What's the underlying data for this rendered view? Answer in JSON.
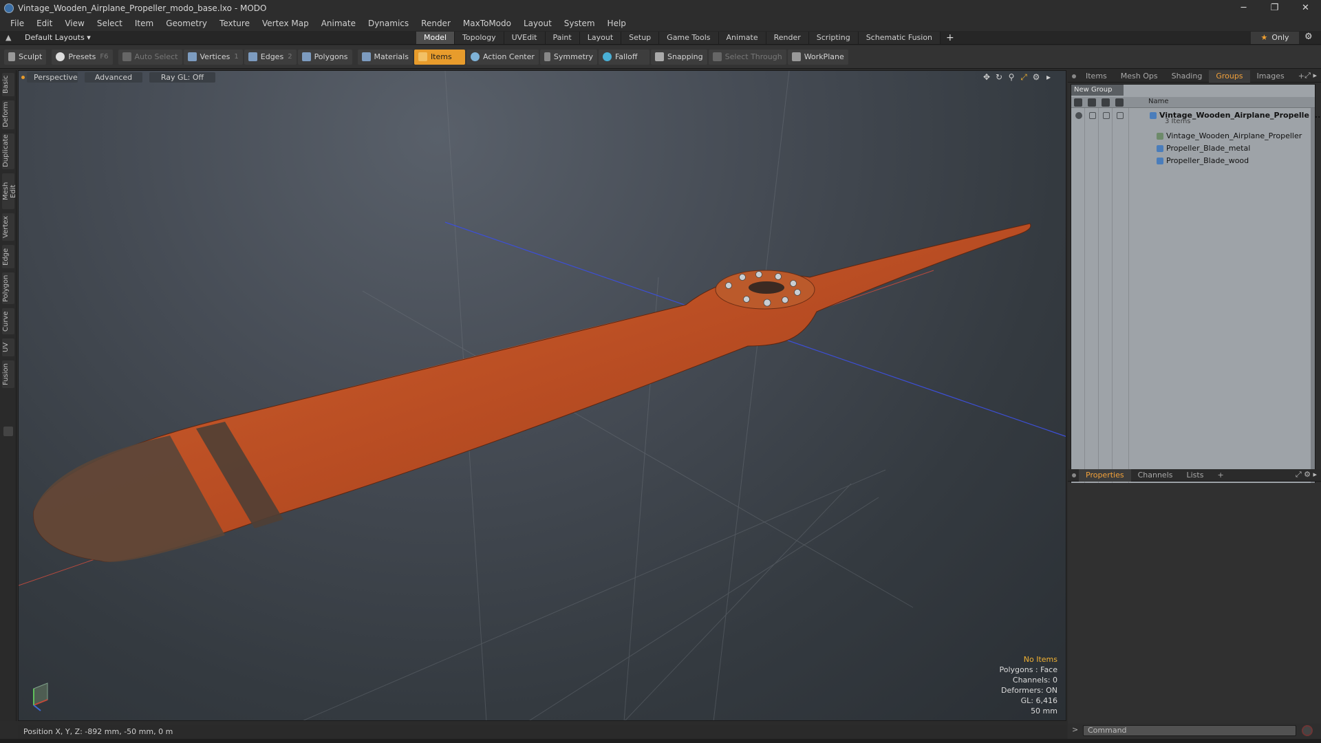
{
  "window": {
    "title": "Vintage_Wooden_Airplane_Propeller_modo_base.lxo - MODO",
    "minimize": "─",
    "maximize": "❐",
    "close": "✕"
  },
  "menu": [
    "File",
    "Edit",
    "View",
    "Select",
    "Item",
    "Geometry",
    "Texture",
    "Vertex Map",
    "Animate",
    "Dynamics",
    "Render",
    "MaxToModo",
    "Layout",
    "System",
    "Help"
  ],
  "layoutbar": {
    "layout_select": "Default Layouts ▾",
    "tabs": [
      "Model",
      "Topology",
      "UVEdit",
      "Paint",
      "Layout",
      "Setup",
      "Game Tools",
      "Animate",
      "Render",
      "Scripting",
      "Schematic Fusion"
    ],
    "active_tab": "Model",
    "add_tab": "+",
    "only_label": "Only",
    "star": "★",
    "gear": "⚙"
  },
  "toolbar": {
    "sculpt": "Sculpt",
    "presets": "Presets",
    "presets_key": "F6",
    "auto_select": "Auto Select",
    "vertices": "Vertices",
    "vertices_key": "1",
    "edges": "Edges",
    "edges_key": "2",
    "polygons": "Polygons",
    "materials": "Materials",
    "items": "Items",
    "action_center": "Action Center",
    "symmetry": "Symmetry",
    "falloff": "Falloff",
    "snapping": "Snapping",
    "select_through": "Select Through",
    "workplane": "WorkPlane"
  },
  "left_tabs": [
    "Basic",
    "Deform",
    "Duplicate",
    "Mesh Edit",
    "Vertex",
    "Edge",
    "Polygon",
    "Curve",
    "UV",
    "Fusion"
  ],
  "viewport": {
    "perspective": "Perspective",
    "advanced": "Advanced",
    "raygl": "Ray GL: Off",
    "icons": [
      "✥",
      "↻",
      "⚲",
      "⤢",
      "⚙",
      "▸"
    ],
    "info": {
      "no_items": "No Items",
      "polygons": "Polygons : Face",
      "channels": "Channels: 0",
      "deformers": "Deformers: ON",
      "gl": "GL: 6,416",
      "scale": "50 mm"
    },
    "colors": {
      "wood": "#c9592b",
      "tip": "#5a4538",
      "axis_blue": "#3d4fd6",
      "axis_red": "#b84a3e"
    }
  },
  "status": {
    "position": "Position X, Y, Z:  -892 mm, -50 mm, 0 m"
  },
  "right_panel": {
    "top_tabs": [
      "Items",
      "Mesh Ops",
      "Shading",
      "Groups",
      "Images"
    ],
    "active_top_tab": "Groups",
    "add": "+",
    "new_group": "New Group",
    "column_name": "Name",
    "tree": {
      "group_name": "Vintage_Wooden_Airplane_Propelle ...",
      "group_count": "3 Items",
      "children": [
        "Vintage_Wooden_Airplane_Propeller",
        "Propeller_Blade_metal",
        "Propeller_Blade_wood"
      ]
    },
    "bottom_tabs": [
      "Properties",
      "Channels",
      "Lists"
    ],
    "active_bottom_tab": "Properties",
    "command_placeholder": "Command",
    "command_arrow": ">"
  }
}
